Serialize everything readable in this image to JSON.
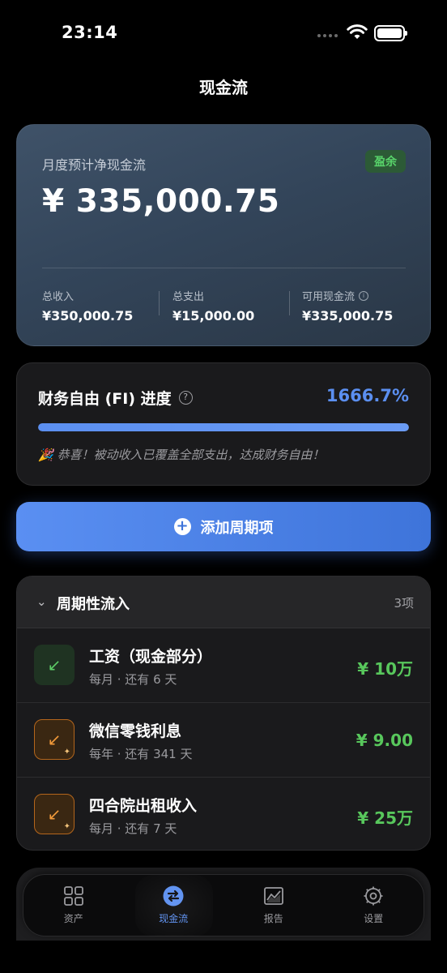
{
  "status_bar": {
    "time": "23:14"
  },
  "nav": {
    "title": "现金流"
  },
  "summary": {
    "label": "月度预计净现金流",
    "badge": "盈余",
    "amount": "¥ 335,000.75",
    "stats": [
      {
        "label": "总收入",
        "value": "¥350,000.75"
      },
      {
        "label": "总支出",
        "value": "¥15,000.00"
      },
      {
        "label": "可用现金流",
        "value": "¥335,000.75"
      }
    ]
  },
  "fi": {
    "title": "财务自由 (FI) 进度",
    "percent": "1666.7%",
    "progress_fraction": 1.0,
    "message": "🎉 恭喜！被动收入已覆盖全部支出，达成财务自由！"
  },
  "add_button": {
    "label": "添加周期项"
  },
  "inflows": {
    "title": "周期性流入",
    "count": "3项",
    "items": [
      {
        "name": "工资（现金部分）",
        "sub": "每月 · 还有 6 天",
        "value": "¥ 10万",
        "icon": "arrow-down-left-icon",
        "style": "green"
      },
      {
        "name": "微信零钱利息",
        "sub": "每年 · 还有 341 天",
        "value": "¥ 9.00",
        "icon": "arrow-down-left-sparkle-icon",
        "style": "orange"
      },
      {
        "name": "四合院出租收入",
        "sub": "每月 · 还有 7 天",
        "value": "¥ 25万",
        "icon": "arrow-down-left-sparkle-icon",
        "style": "orange"
      }
    ]
  },
  "tabs": [
    {
      "label": "资产",
      "icon": "grid-icon",
      "active": false
    },
    {
      "label": "现金流",
      "icon": "exchange-icon",
      "active": true
    },
    {
      "label": "报告",
      "icon": "chart-icon",
      "active": false
    },
    {
      "label": "设置",
      "icon": "gear-icon",
      "active": false
    }
  ],
  "colors": {
    "accent": "#5b8ff0",
    "positive": "#58c75c",
    "surplus_badge": "#2c5a36",
    "warning": "#f29a3a"
  }
}
